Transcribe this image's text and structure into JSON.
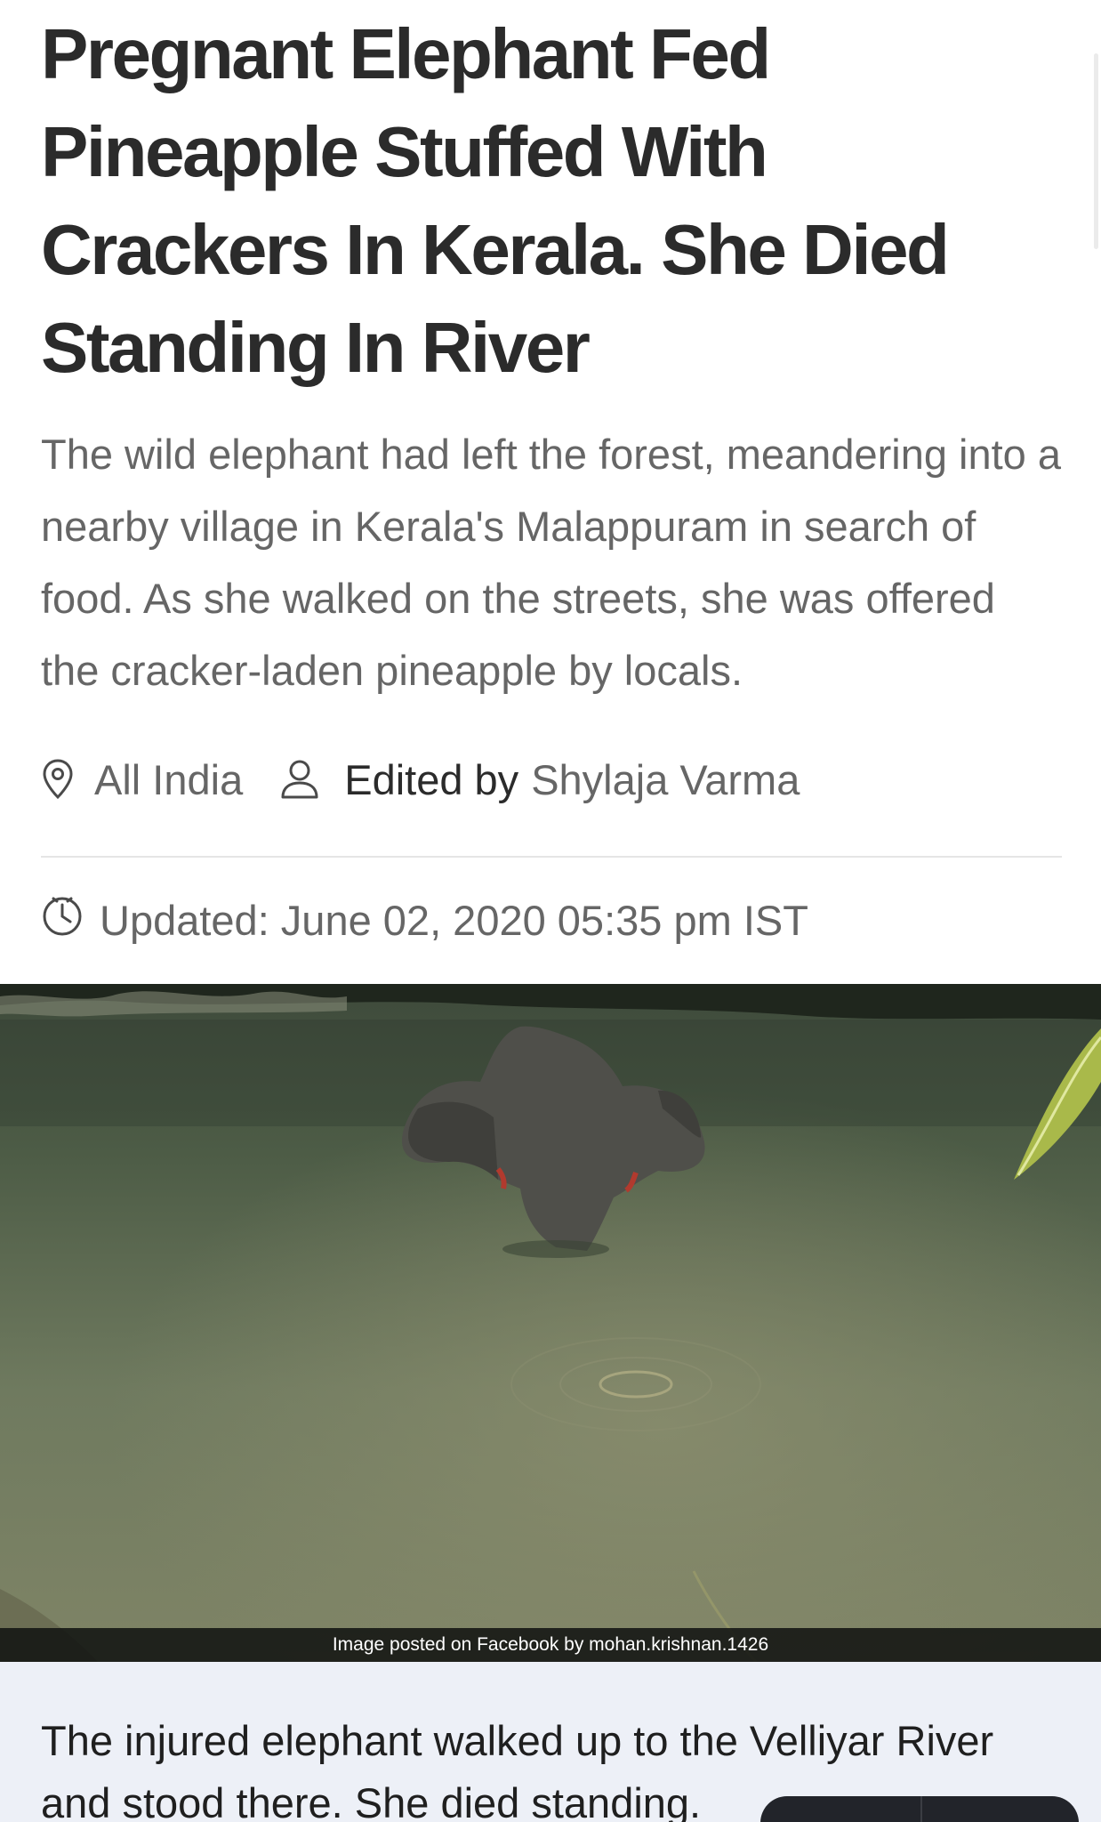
{
  "article": {
    "headline": "Pregnant Elephant Fed Pineapple Stuffed With Crackers In Kerala. She Died Standing In River",
    "synopsis": "The wild elephant had left the forest, meandering into a nearby village in Kerala's Malappuram in search of food. As she walked on the streets, she was offered the cracker-laden pineapple by locals.",
    "meta": {
      "location_icon": "location-pin-icon",
      "location": "All India",
      "editor_icon": "person-icon",
      "editor_prefix": "Edited by",
      "editor_name": "Shylaja Varma"
    },
    "updated": {
      "icon": "clock-icon",
      "text": "Updated: June 02, 2020 05:35 pm IST"
    },
    "image": {
      "credit": "Image posted on Facebook by mohan.krishnan.1426"
    },
    "caption": "The injured elephant walked up to the Velliyar River and stood there. She died standing."
  },
  "colors": {
    "headline": "#2b2b2b",
    "body_text": "#666666",
    "caption_bg": "#edf0f7",
    "floating_bar": "#22242a"
  }
}
